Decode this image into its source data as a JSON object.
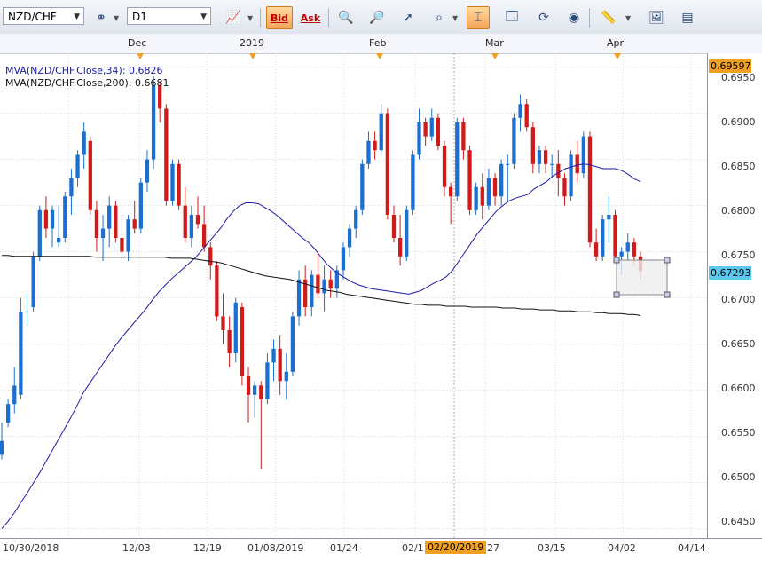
{
  "toolbar": {
    "symbol": "NZD/CHF",
    "timeframe": "D1",
    "bid_label": "Bid",
    "ask_label": "Ask"
  },
  "time_axis": {
    "top_labels": [
      "Dec",
      "2019",
      "Feb",
      "Mar",
      "Apr"
    ],
    "bottom_labels": [
      "10/30/2018",
      "12/03",
      "12/19",
      "01/08/2019",
      "01/24",
      "02/1",
      "27",
      "03/15",
      "04/02",
      "04/14"
    ],
    "crosshair_date": "02/20/2019"
  },
  "price_axis": {
    "labels": [
      "0.6950",
      "0.6900",
      "0.6850",
      "0.6800",
      "0.6750",
      "0.6700",
      "0.6650",
      "0.6600",
      "0.6550",
      "0.6500",
      "0.6450"
    ],
    "top_marker": "0.69597",
    "current_price": "0.67293"
  },
  "legend": {
    "line1": "MVA(NZD/CHF.Close,34): 0.6826",
    "line2": "MVA(NZD/CHF.Close,200): 0.6681"
  },
  "colors": {
    "up": "#1a6fd1",
    "down": "#d11a1a",
    "ma34": "#1a1aa8",
    "ma200": "#111111",
    "marker": "#f0a020",
    "current_price_bg": "#5bc8f0"
  },
  "chart_data": {
    "type": "candlestick",
    "ylim": [
      0.644,
      0.6965
    ],
    "candles": [
      [
        0.653,
        0.6565,
        0.6525,
        0.6545
      ],
      [
        0.6565,
        0.659,
        0.656,
        0.6585
      ],
      [
        0.6585,
        0.6625,
        0.6575,
        0.6605
      ],
      [
        0.6595,
        0.67,
        0.659,
        0.6685
      ],
      [
        0.6685,
        0.6705,
        0.667,
        0.6685
      ],
      [
        0.669,
        0.675,
        0.6685,
        0.6745
      ],
      [
        0.6745,
        0.68,
        0.674,
        0.6795
      ],
      [
        0.6795,
        0.681,
        0.6765,
        0.6775
      ],
      [
        0.6775,
        0.68,
        0.6755,
        0.6795
      ],
      [
        0.676,
        0.68,
        0.6755,
        0.6765
      ],
      [
        0.6765,
        0.6815,
        0.676,
        0.681
      ],
      [
        0.681,
        0.684,
        0.679,
        0.683
      ],
      [
        0.683,
        0.686,
        0.682,
        0.6855
      ],
      [
        0.6855,
        0.689,
        0.684,
        0.688
      ],
      [
        0.687,
        0.6875,
        0.679,
        0.6795
      ],
      [
        0.6795,
        0.6805,
        0.675,
        0.6765
      ],
      [
        0.6765,
        0.679,
        0.674,
        0.6775
      ],
      [
        0.6775,
        0.681,
        0.6755,
        0.68
      ],
      [
        0.68,
        0.6805,
        0.676,
        0.6765
      ],
      [
        0.6765,
        0.679,
        0.674,
        0.675
      ],
      [
        0.675,
        0.679,
        0.674,
        0.6785
      ],
      [
        0.6785,
        0.6805,
        0.677,
        0.6775
      ],
      [
        0.6775,
        0.683,
        0.677,
        0.6825
      ],
      [
        0.6825,
        0.686,
        0.6815,
        0.685
      ],
      [
        0.685,
        0.694,
        0.684,
        0.693
      ],
      [
        0.693,
        0.6935,
        0.689,
        0.6905
      ],
      [
        0.6905,
        0.691,
        0.68,
        0.6805
      ],
      [
        0.6805,
        0.685,
        0.68,
        0.6845
      ],
      [
        0.6845,
        0.685,
        0.6795,
        0.68
      ],
      [
        0.68,
        0.682,
        0.676,
        0.6765
      ],
      [
        0.6765,
        0.68,
        0.6755,
        0.679
      ],
      [
        0.679,
        0.681,
        0.6775,
        0.678
      ],
      [
        0.678,
        0.68,
        0.675,
        0.6755
      ],
      [
        0.6755,
        0.676,
        0.672,
        0.6735
      ],
      [
        0.6735,
        0.674,
        0.6675,
        0.668
      ],
      [
        0.668,
        0.6705,
        0.665,
        0.6665
      ],
      [
        0.6665,
        0.668,
        0.6625,
        0.664
      ],
      [
        0.664,
        0.67,
        0.663,
        0.6695
      ],
      [
        0.669,
        0.6695,
        0.6605,
        0.6615
      ],
      [
        0.6615,
        0.6625,
        0.6565,
        0.6595
      ],
      [
        0.6595,
        0.661,
        0.657,
        0.6605
      ],
      [
        0.6605,
        0.661,
        0.6515,
        0.659
      ],
      [
        0.659,
        0.664,
        0.6585,
        0.663
      ],
      [
        0.663,
        0.6655,
        0.661,
        0.6645
      ],
      [
        0.6645,
        0.666,
        0.6595,
        0.661
      ],
      [
        0.661,
        0.664,
        0.659,
        0.662
      ],
      [
        0.662,
        0.6685,
        0.6615,
        0.668
      ],
      [
        0.668,
        0.673,
        0.667,
        0.672
      ],
      [
        0.672,
        0.6735,
        0.668,
        0.669
      ],
      [
        0.669,
        0.673,
        0.668,
        0.6725
      ],
      [
        0.6725,
        0.675,
        0.67,
        0.6705
      ],
      [
        0.6705,
        0.6735,
        0.6685,
        0.672
      ],
      [
        0.672,
        0.673,
        0.67,
        0.671
      ],
      [
        0.671,
        0.6735,
        0.67,
        0.673
      ],
      [
        0.673,
        0.676,
        0.672,
        0.6755
      ],
      [
        0.6755,
        0.678,
        0.6745,
        0.6775
      ],
      [
        0.6775,
        0.68,
        0.6765,
        0.6795
      ],
      [
        0.6795,
        0.685,
        0.679,
        0.6845
      ],
      [
        0.6845,
        0.688,
        0.684,
        0.687
      ],
      [
        0.687,
        0.688,
        0.685,
        0.686
      ],
      [
        0.686,
        0.691,
        0.6855,
        0.69
      ],
      [
        0.69,
        0.6905,
        0.6785,
        0.679
      ],
      [
        0.679,
        0.68,
        0.676,
        0.6765
      ],
      [
        0.6765,
        0.679,
        0.6735,
        0.6745
      ],
      [
        0.6745,
        0.68,
        0.674,
        0.6795
      ],
      [
        0.6795,
        0.686,
        0.679,
        0.6855
      ],
      [
        0.6855,
        0.6905,
        0.685,
        0.689
      ],
      [
        0.689,
        0.6895,
        0.6865,
        0.6875
      ],
      [
        0.6875,
        0.6905,
        0.687,
        0.6895
      ],
      [
        0.6895,
        0.69,
        0.686,
        0.6865
      ],
      [
        0.6865,
        0.687,
        0.681,
        0.682
      ],
      [
        0.682,
        0.6825,
        0.678,
        0.681
      ],
      [
        0.681,
        0.6895,
        0.6805,
        0.689
      ],
      [
        0.689,
        0.6895,
        0.685,
        0.686
      ],
      [
        0.686,
        0.6865,
        0.679,
        0.6795
      ],
      [
        0.6795,
        0.6825,
        0.679,
        0.682
      ],
      [
        0.682,
        0.6835,
        0.6785,
        0.68
      ],
      [
        0.68,
        0.684,
        0.6795,
        0.683
      ],
      [
        0.683,
        0.6835,
        0.68,
        0.681
      ],
      [
        0.681,
        0.685,
        0.68,
        0.6845
      ],
      [
        0.6845,
        0.6855,
        0.6805,
        0.6845
      ],
      [
        0.6845,
        0.69,
        0.684,
        0.6895
      ],
      [
        0.6895,
        0.692,
        0.688,
        0.691
      ],
      [
        0.691,
        0.6915,
        0.688,
        0.6885
      ],
      [
        0.6885,
        0.689,
        0.6835,
        0.6845
      ],
      [
        0.6845,
        0.6865,
        0.6835,
        0.686
      ],
      [
        0.686,
        0.6865,
        0.6835,
        0.6845
      ],
      [
        0.6845,
        0.6855,
        0.683,
        0.6845
      ],
      [
        0.6845,
        0.686,
        0.681,
        0.683
      ],
      [
        0.683,
        0.6835,
        0.68,
        0.681
      ],
      [
        0.681,
        0.686,
        0.6805,
        0.6855
      ],
      [
        0.6855,
        0.687,
        0.6825,
        0.6835
      ],
      [
        0.6835,
        0.688,
        0.683,
        0.6875
      ],
      [
        0.6875,
        0.688,
        0.6755,
        0.676
      ],
      [
        0.676,
        0.6775,
        0.674,
        0.6745
      ],
      [
        0.6745,
        0.679,
        0.674,
        0.6785
      ],
      [
        0.6785,
        0.681,
        0.676,
        0.679
      ],
      [
        0.679,
        0.6795,
        0.674,
        0.6745
      ],
      [
        0.6745,
        0.6755,
        0.6725,
        0.675
      ],
      [
        0.675,
        0.677,
        0.674,
        0.676
      ],
      [
        0.676,
        0.6765,
        0.6735,
        0.6745
      ],
      [
        0.6745,
        0.675,
        0.672,
        0.6729
      ]
    ],
    "ma34": [
      0.645,
      0.6458,
      0.6467,
      0.6478,
      0.6488,
      0.6499,
      0.651,
      0.6522,
      0.6534,
      0.6546,
      0.6558,
      0.657,
      0.6583,
      0.6597,
      0.6607,
      0.6617,
      0.6627,
      0.6637,
      0.6647,
      0.6656,
      0.6664,
      0.6672,
      0.668,
      0.6688,
      0.6697,
      0.6706,
      0.6713,
      0.672,
      0.6726,
      0.6732,
      0.6738,
      0.6744,
      0.6752,
      0.676,
      0.6768,
      0.6776,
      0.6786,
      0.6794,
      0.68,
      0.6803,
      0.6803,
      0.6802,
      0.6798,
      0.6794,
      0.6789,
      0.6783,
      0.6777,
      0.6771,
      0.6765,
      0.676,
      0.6753,
      0.6744,
      0.6736,
      0.673,
      0.6725,
      0.6721,
      0.6717,
      0.6714,
      0.6712,
      0.671,
      0.6709,
      0.6708,
      0.6707,
      0.6706,
      0.6705,
      0.6704,
      0.6706,
      0.6708,
      0.6712,
      0.6716,
      0.6719,
      0.6723,
      0.673,
      0.674,
      0.675,
      0.676,
      0.677,
      0.6778,
      0.6786,
      0.6794,
      0.68,
      0.6805,
      0.6808,
      0.681,
      0.6812,
      0.6818,
      0.6822,
      0.6826,
      0.6832,
      0.6836,
      0.684,
      0.6842,
      0.6844,
      0.6845,
      0.6844,
      0.6842,
      0.684,
      0.684,
      0.684,
      0.6838,
      0.6834,
      0.6829,
      0.6826
    ],
    "ma200": [
      0.6746,
      0.6746,
      0.6745,
      0.6745,
      0.6745,
      0.6745,
      0.6745,
      0.6745,
      0.6745,
      0.6745,
      0.6745,
      0.6745,
      0.6745,
      0.6745,
      0.6745,
      0.6744,
      0.6744,
      0.6744,
      0.6744,
      0.6744,
      0.6744,
      0.6744,
      0.6744,
      0.6744,
      0.6744,
      0.6744,
      0.6744,
      0.6743,
      0.6743,
      0.6743,
      0.6743,
      0.6742,
      0.6741,
      0.674,
      0.6739,
      0.6738,
      0.6736,
      0.6734,
      0.6732,
      0.673,
      0.6728,
      0.6726,
      0.6724,
      0.6723,
      0.6722,
      0.6721,
      0.672,
      0.6718,
      0.6716,
      0.6714,
      0.6712,
      0.671,
      0.6708,
      0.6707,
      0.6706,
      0.6704,
      0.6703,
      0.6702,
      0.6701,
      0.67,
      0.6699,
      0.6698,
      0.6697,
      0.6696,
      0.6695,
      0.6694,
      0.6693,
      0.6693,
      0.6692,
      0.6692,
      0.6692,
      0.6691,
      0.6691,
      0.6691,
      0.6691,
      0.669,
      0.669,
      0.669,
      0.669,
      0.669,
      0.6689,
      0.6689,
      0.6689,
      0.6688,
      0.6688,
      0.6688,
      0.6687,
      0.6687,
      0.6687,
      0.6686,
      0.6686,
      0.6686,
      0.6685,
      0.6685,
      0.6685,
      0.6684,
      0.6684,
      0.6683,
      0.6683,
      0.6683,
      0.6682,
      0.6682,
      0.6681
    ]
  }
}
